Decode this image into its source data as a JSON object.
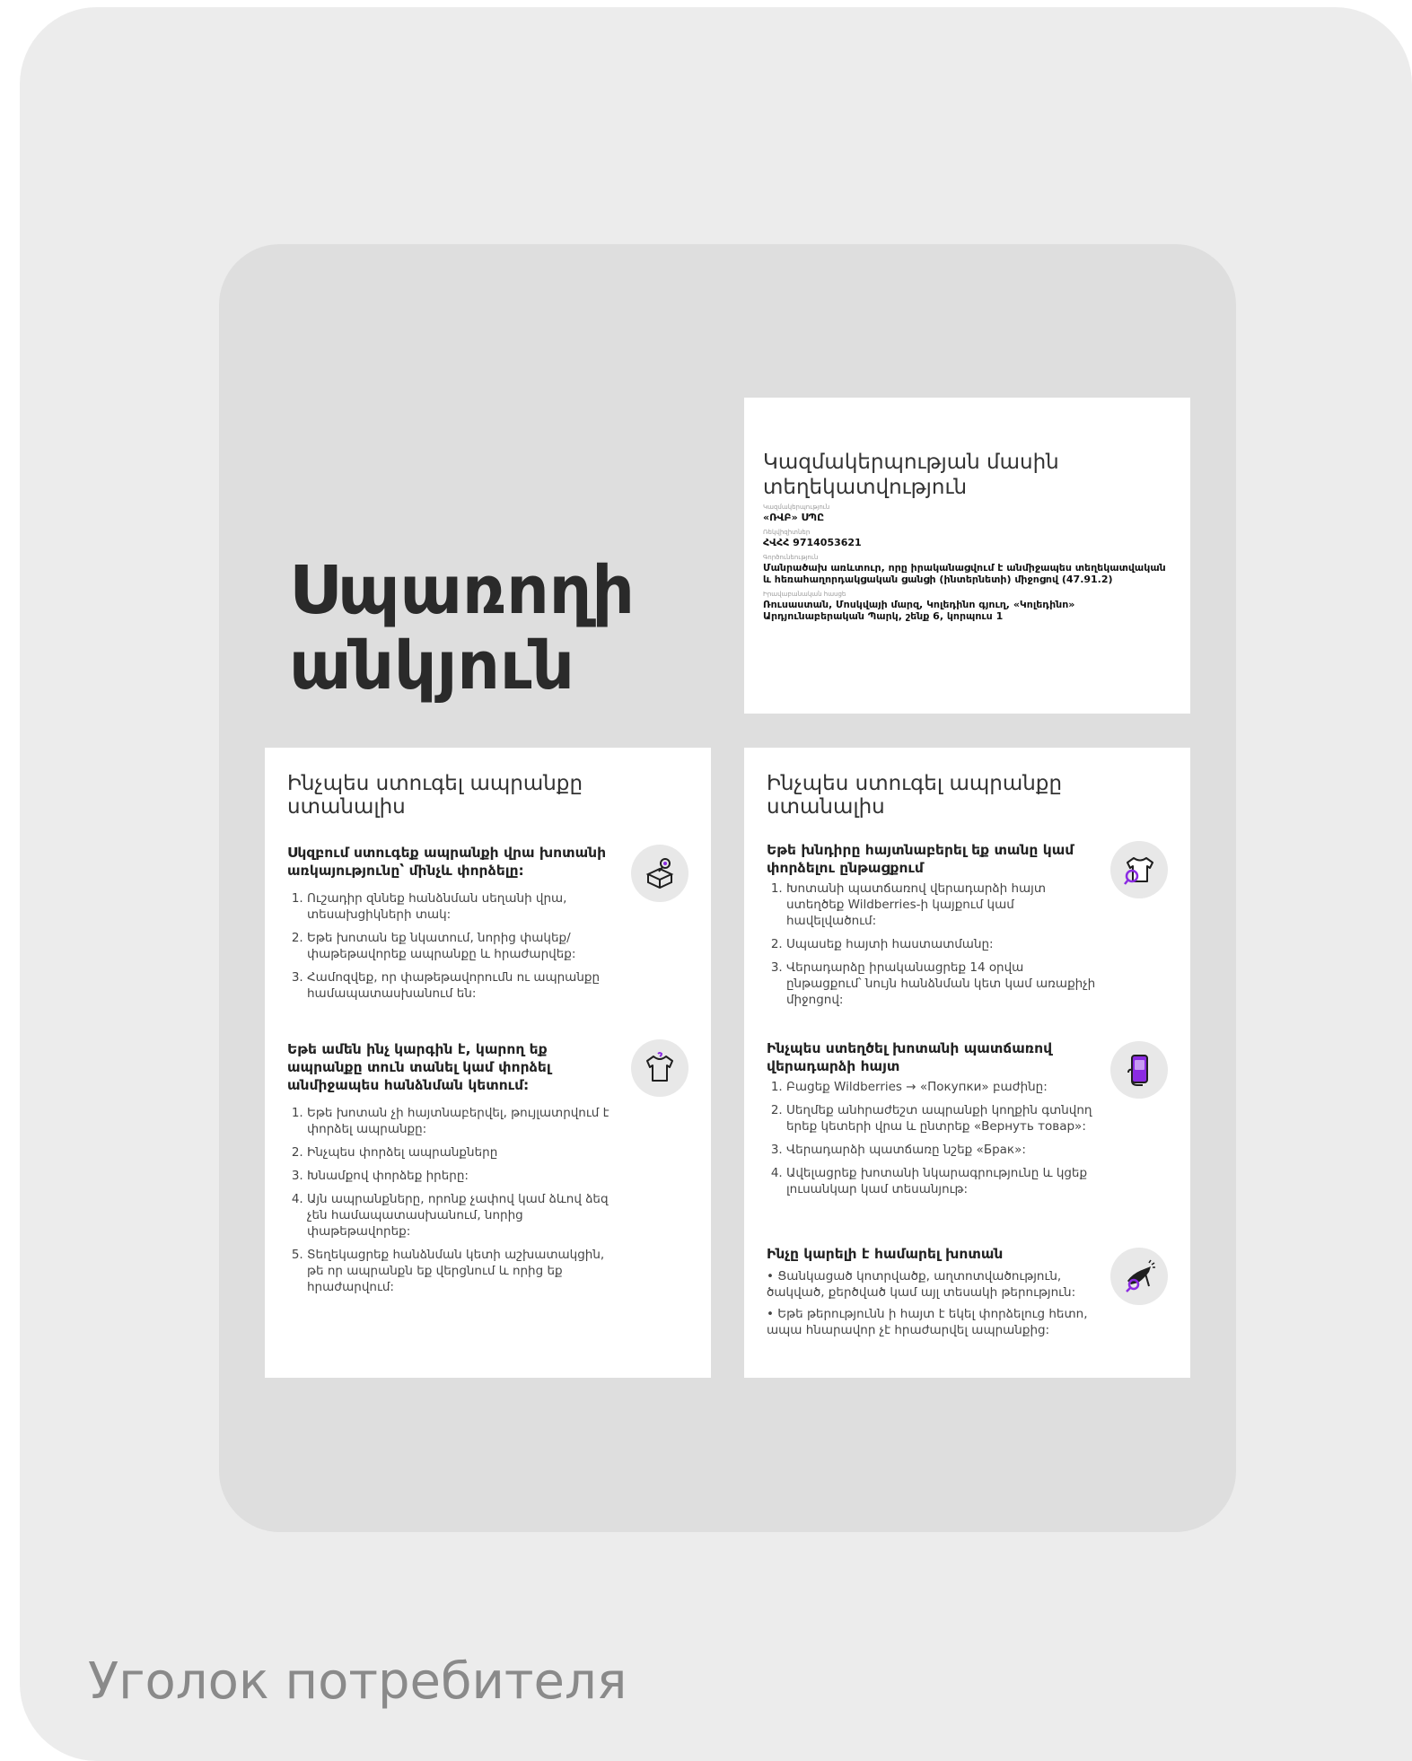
{
  "page_title": "Սպառողի անկյուն",
  "footer_title": "Уголок потребителя",
  "colors": {
    "accent": "#8b2be2",
    "card": "#ffffff",
    "panel": "#dedede",
    "outer": "#ececec"
  },
  "org_card": {
    "title": "Կազմակերպության մասին տեղեկատվություն",
    "fields": [
      {
        "label": "Կազմակերպություն",
        "value": "«ՌՎԲ» ՍՊԸ"
      },
      {
        "label": "Ռեկվիզիտներ",
        "value": "ՀՎՀՀ 9714053621"
      },
      {
        "label": "Գործունեություն",
        "value": "Մանրածախ առևտուր, որը իրականացվում է անմիջապես տեղեկատվական և հեռահաղորդակցական ցանցի (ինտերնետի) միջոցով (47.91.2)"
      },
      {
        "label": "Իրավաբանական հասցե",
        "value": "Ռուսաստան, Մոսկվայի մարզ, Կոլեդինո գյուղ, «Կոլեդինո» Արդյունաբերական Պարկ, շենք 6, կորպուս 1"
      }
    ]
  },
  "left_card": {
    "title": "Ինչպես ստուգել ապրանքը ստանալիս",
    "sections": [
      {
        "heading": "Սկզբում ստուգեք ապրանքի վրա խոտանի առկայությունը՝ մինչև փորձելը:",
        "icon": "box-magnifier-icon",
        "items": [
          "Ուշադիր զննեք հանձնման սեղանի վրա, տեսախցիկների տակ:",
          "Եթե խոտան եք նկատում, նորից փակեք/փաթեթավորեք ապրանքը և հրաժարվեք:",
          "Համոզվեք, որ փաթեթավորումն ու ապրանքը համապատասխանում են:"
        ]
      },
      {
        "heading": "Եթե ամեն ինչ կարգին է, կարող եք ապրանքը տուն տանել կամ փորձել անմիջապես հանձնման կետում:",
        "icon": "tshirt-icon",
        "items": [
          "Եթե խոտան չի հայտնաբերվել, թույլատրվում է փորձել ապրանքը:",
          "Ինչպես փորձել ապրանքները",
          "Խնամքով փորձեք իրերը:",
          "Այն ապրանքները, որոնք չափով կամ ձևով ձեզ չեն համապատասխանում, նորից փաթեթավորեք:",
          "Տեղեկացրեք հանձնման կետի աշխատակցին, թե որ ապրանքն եք վերցնում և որից եք հրաժարվում:"
        ]
      }
    ]
  },
  "right_card": {
    "title": "Ինչպես ստուգել ապրանքը ստանալիս",
    "sections": [
      {
        "heading": "Եթե խնդիրը հայտնաբերել եք տանը կամ փորձելու ընթացքում",
        "icon": "shirt-search-icon",
        "items": [
          "Խոտանի պատճառով վերադարձի հայտ ստեղծեք Wildberries-ի կայքում կամ հավելվածում:",
          "Սպասեք հայտի հաստատմանը:",
          "Վերադարձը իրականացրեք 14 օրվա ընթացքում՝ նույն հանձնման կետ կամ առաքիչի միջոցով:"
        ]
      },
      {
        "heading": "Ինչպես ստեղծել խոտանի պատճառով վերադարձի հայտ",
        "icon": "phone-icon",
        "items": [
          "Բացեք Wildberries → «Покупки» բաժինը:",
          "Սեղմեք անհրաժեշտ ապրանքի կողքին գտնվող երեք կետերի վրա և ընտրեք «Вернуть товар»:",
          "Վերադարձի պատճառը նշեք «Брак»:",
          "Ավելացրեք խոտանի նկարագրությունը և կցեք լուսանկար կամ տեսանյութ:"
        ]
      },
      {
        "heading": "Ինչը կարելի է համարել խոտան",
        "icon": "shoe-search-icon",
        "bullets": [
          "• Ցանկացած կոտրվածք, աղտոտվածություն, ծակված, քերծված կամ այլ տեսակի թերություն:",
          "• Եթե թերությունն ի հայտ է եկել փորձելուց հետո, ապա հնարավոր չէ հրաժարվել ապրանքից:"
        ]
      }
    ]
  }
}
